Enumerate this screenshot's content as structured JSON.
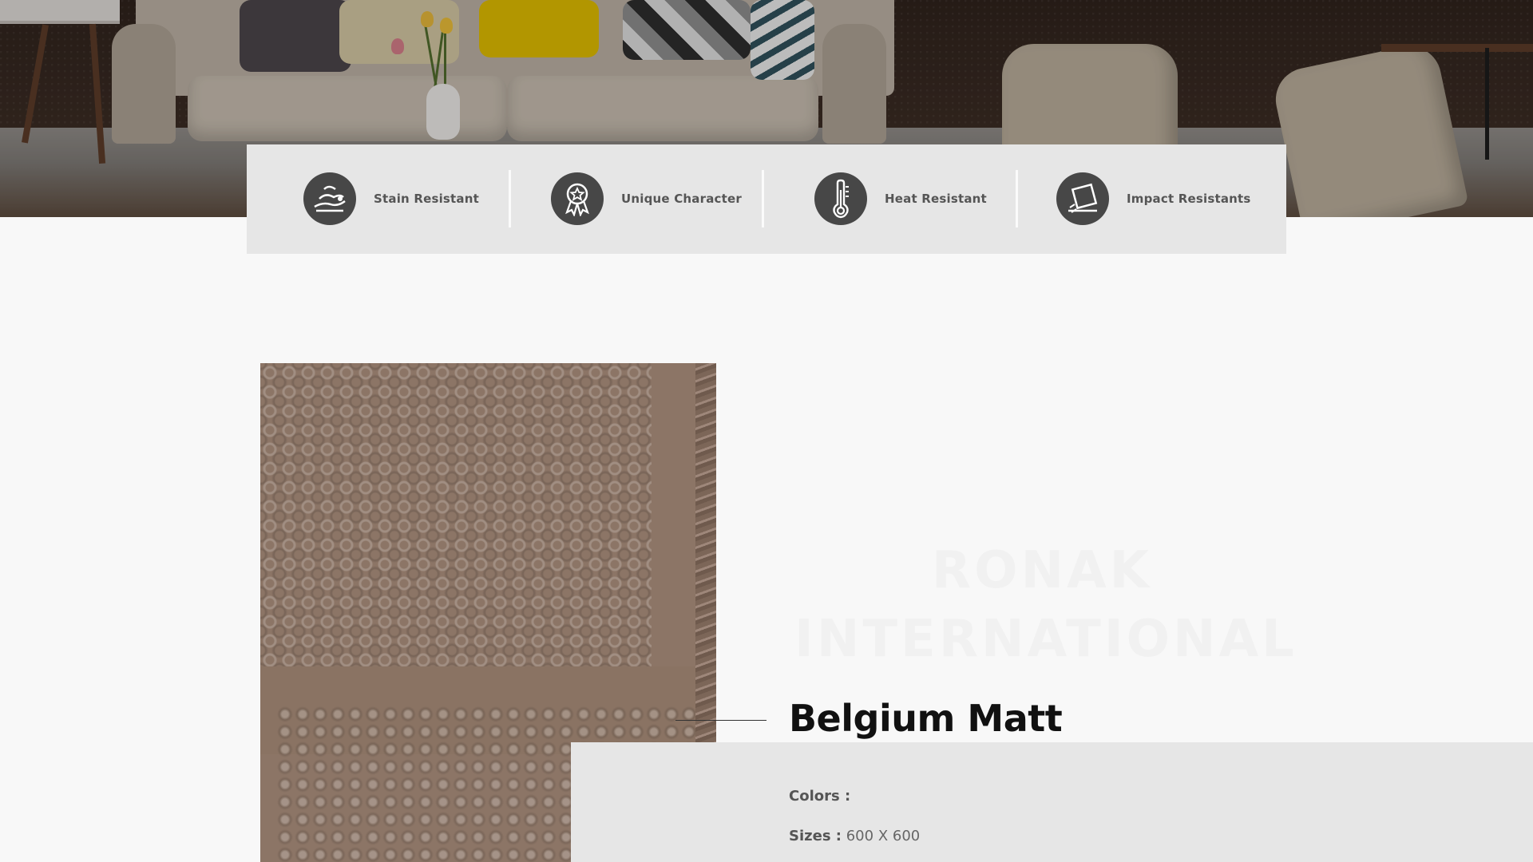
{
  "features": [
    {
      "label": "Stain Resistant",
      "icon": "stain-resistant-icon"
    },
    {
      "label": "Unique Character",
      "icon": "award-badge-icon"
    },
    {
      "label": "Heat Resistant",
      "icon": "thermometer-icon"
    },
    {
      "label": "Impact Resistants",
      "icon": "impact-tile-icon"
    }
  ],
  "watermark": {
    "line1": "RONAK",
    "line2": "INTERNATIONAL"
  },
  "product": {
    "title": "Belgium Matt",
    "colors_label": "Colors :",
    "colors_value": "",
    "sizes_label": "Sizes :",
    "sizes_value": "600 X 600"
  },
  "colors": {
    "feature_bar_bg": "#e6e6e6",
    "icon_circle": "#474747",
    "tile_brown": "#8c7566",
    "page_bg": "#f8f8f8"
  }
}
